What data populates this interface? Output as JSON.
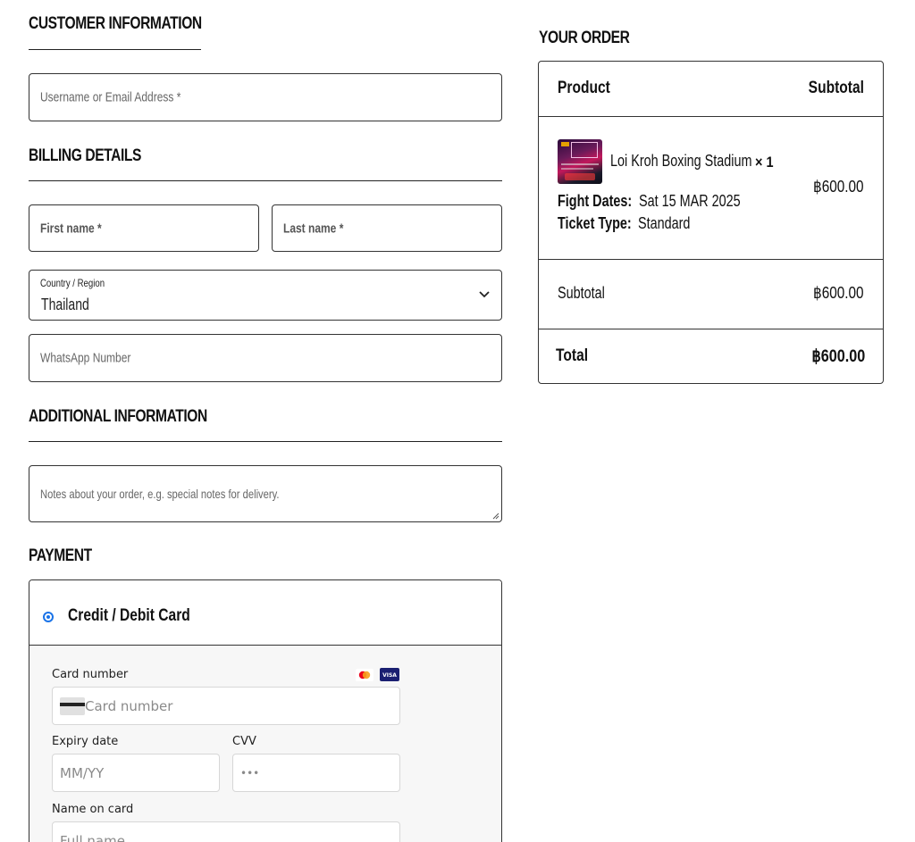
{
  "customer_info": {
    "title": "CUSTOMER INFORMATION",
    "username_placeholder": "Username or Email Address *"
  },
  "billing": {
    "title": "BILLING DETAILS",
    "first_name_placeholder": "First name *",
    "last_name_placeholder": "Last name *",
    "country_label": "Country / Region",
    "country_value": "Thailand",
    "whatsapp_placeholder": "WhatsApp Number"
  },
  "additional": {
    "title": "ADDITIONAL INFORMATION",
    "notes_placeholder": "Notes about your order, e.g. special notes for delivery."
  },
  "payment": {
    "title": "PAYMENT",
    "method": "Credit / Debit Card",
    "card_number_label": "Card number",
    "card_number_placeholder": "Card number",
    "expiry_label": "Expiry date",
    "expiry_placeholder": "MM/YY",
    "cvv_label": "CVV",
    "cvv_placeholder": "•••",
    "name_label": "Name on card",
    "name_placeholder": "Full name",
    "card_brands": [
      "mastercard-icon",
      "visa-icon"
    ],
    "visa_text": "VISA"
  },
  "order": {
    "title": "YOUR ORDER",
    "col_product": "Product",
    "col_subtotal": "Subtotal",
    "item": {
      "name": "Loi Kroh Boxing Stadium",
      "qty": "× 1",
      "fight_dates_label": "Fight Dates:",
      "fight_dates_value": "Sat 15 MAR 2025",
      "ticket_type_label": "Ticket Type:",
      "ticket_type_value": "Standard",
      "price": "฿600.00"
    },
    "subtotal_label": "Subtotal",
    "subtotal_value": "฿600.00",
    "total_label": "Total",
    "total_value": "฿600.00"
  },
  "colors": {
    "accent": "#1a73e8",
    "border": "#333333",
    "visa_blue": "#1a1f71",
    "mastercard_red": "#eb001b",
    "mastercard_orange": "#f79e1b"
  }
}
